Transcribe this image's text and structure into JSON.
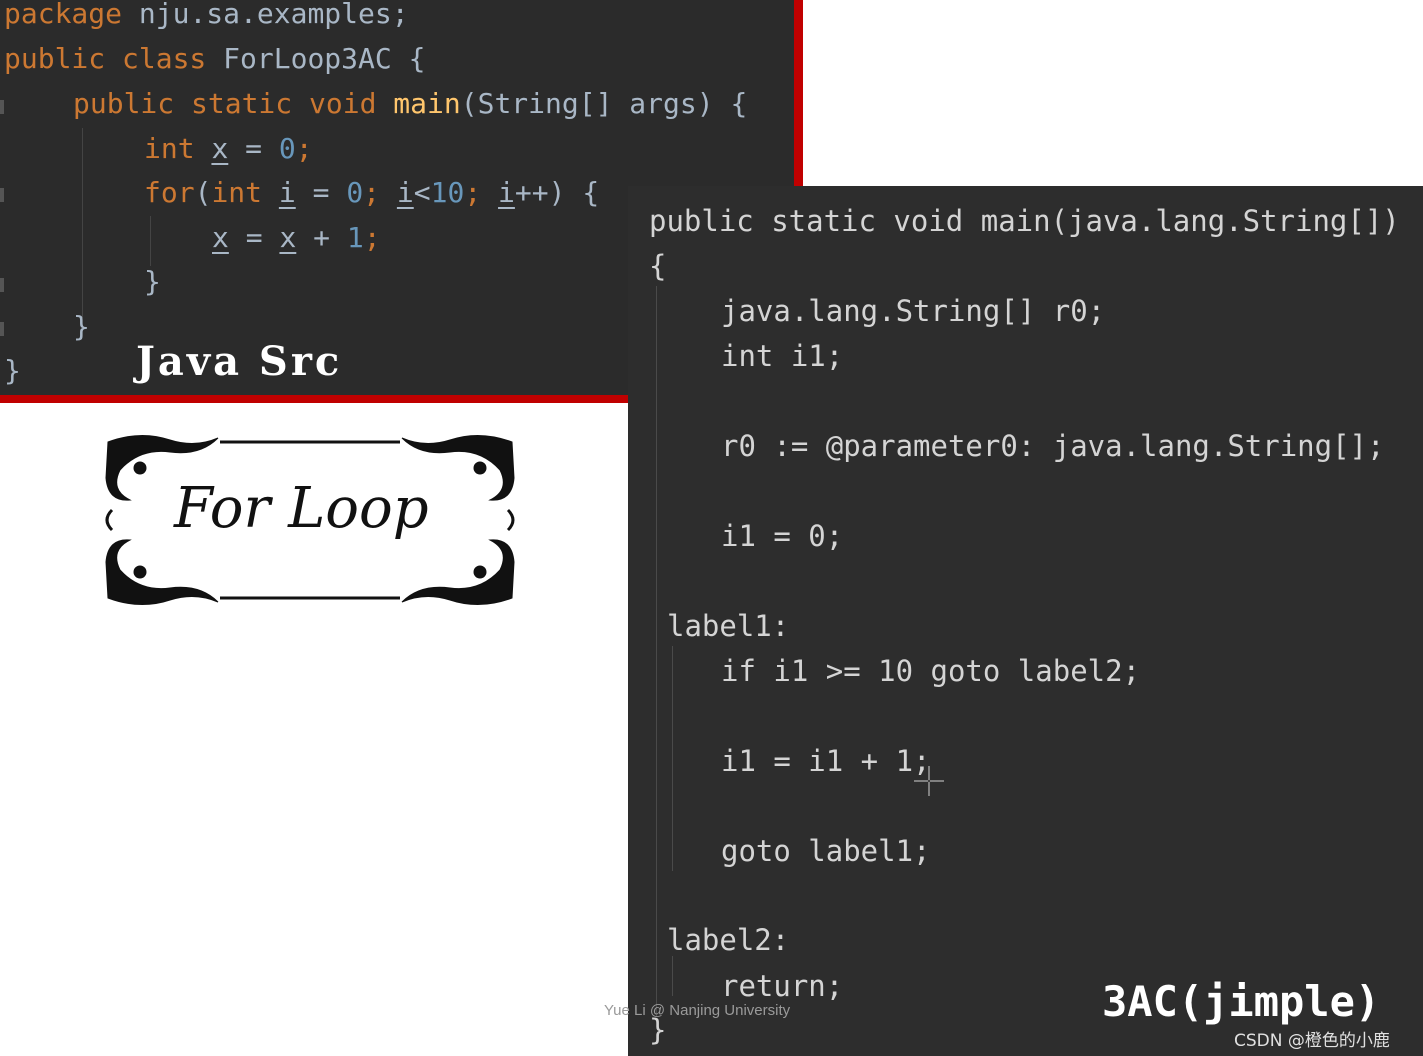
{
  "java_source": {
    "line1": {
      "kw": "package",
      "rest": " nju.sa.examples;"
    },
    "line2": {
      "kw": "public class",
      "rest": " ForLoop3AC {"
    },
    "line3": {
      "kw": "public static void ",
      "fn": "main",
      "rest": "(String[] args) {"
    },
    "line4": {
      "kw": "int ",
      "var": "x",
      "op": " = ",
      "num": "0",
      "end": ";"
    },
    "line5": {
      "kw1": "for",
      "p1": "(",
      "kw2": "int ",
      "var1": "i",
      "op1": " = ",
      "num1": "0",
      "p2": "; ",
      "var2": "i",
      "op2": "<",
      "num2": "10",
      "p3": "; ",
      "var3": "i",
      "op3": "++) {"
    },
    "line6": {
      "var1": "x",
      "op1": " = ",
      "var2": "x",
      "op2": " + ",
      "num": "1",
      "end": ";"
    },
    "line7": "}",
    "line8": "}",
    "line9": "}",
    "caption": "Java Src"
  },
  "banner": {
    "text": "For Loop"
  },
  "jimple": {
    "lines": [
      "public static void main(java.lang.String[])",
      "{",
      "java.lang.String[] r0;",
      "int i1;",
      "r0 := @parameter0: java.lang.String[];",
      "i1 = 0;",
      "label1:",
      "if i1 >= 10 goto label2;",
      "i1 = i1 + 1;",
      "goto label1;",
      "label2:",
      "return;",
      "}"
    ],
    "caption": "3AC(jimple)"
  },
  "watermark": "Yue Li @ Nanjing University",
  "csdn_credit": "CSDN @橙色的小鹿",
  "colors": {
    "keyword": "#cc7832",
    "function": "#ffc66d",
    "number": "#6897bb",
    "text": "#a9b7c6",
    "accent_red": "#c00000"
  }
}
